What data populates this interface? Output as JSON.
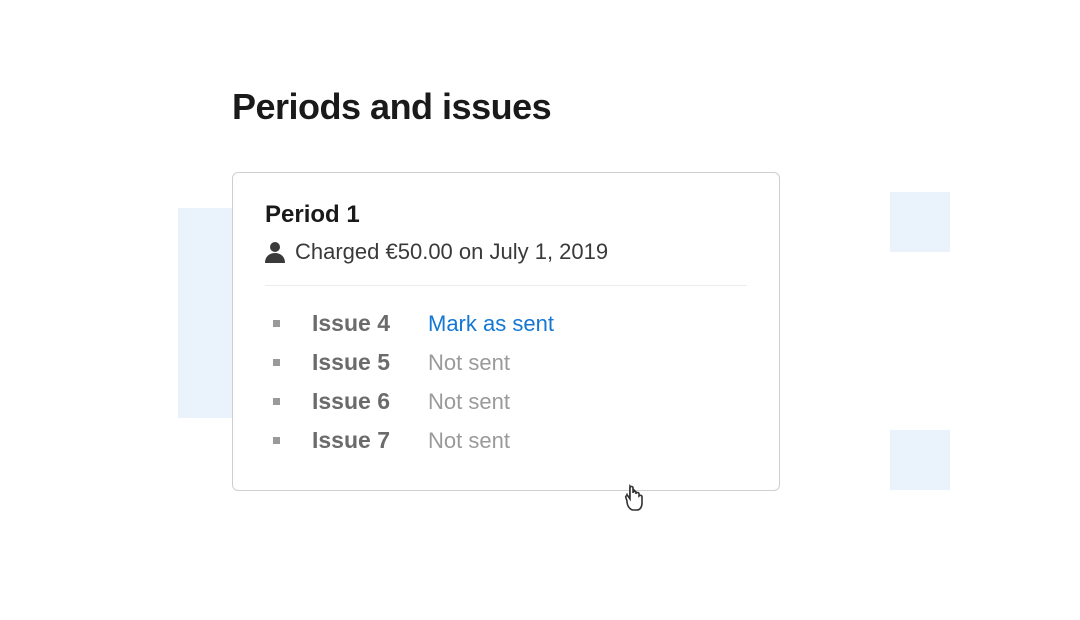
{
  "page": {
    "title": "Periods and issues"
  },
  "period": {
    "title": "Period 1",
    "charged_text": "Charged €50.00 on July 1, 2019",
    "issues": [
      {
        "label": "Issue 4",
        "status": "Mark as sent",
        "action": true
      },
      {
        "label": "Issue 5",
        "status": "Not sent",
        "action": false
      },
      {
        "label": "Issue 6",
        "status": "Not sent",
        "action": false
      },
      {
        "label": "Issue 7",
        "status": "Not sent",
        "action": false
      }
    ]
  },
  "colors": {
    "link": "#1477d4",
    "muted": "#9a9a9a",
    "bg_accent": "#eaf2fc"
  }
}
